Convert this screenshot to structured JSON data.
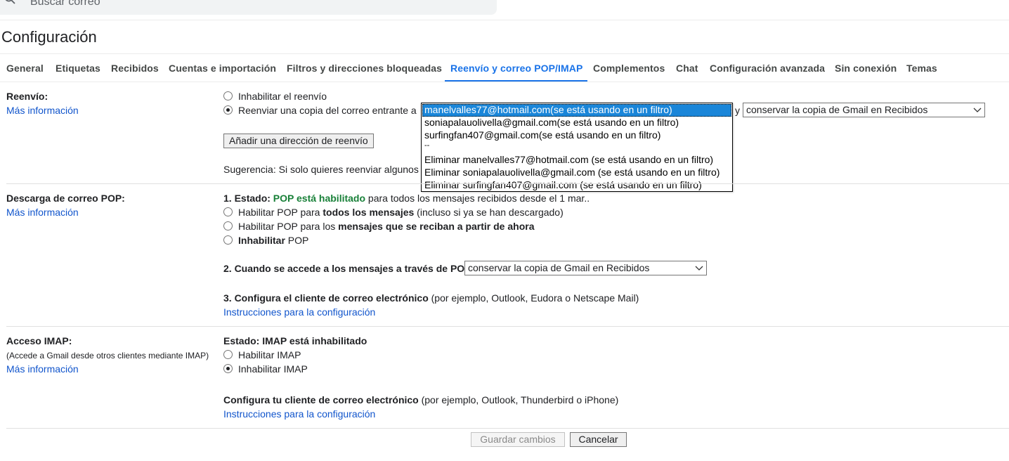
{
  "search": {
    "placeholder": "Buscar correo"
  },
  "page": {
    "title": "Configuración"
  },
  "tabs": [
    {
      "label": "General"
    },
    {
      "label": "Etiquetas"
    },
    {
      "label": "Recibidos"
    },
    {
      "label": "Cuentas e importación"
    },
    {
      "label": "Filtros y direcciones bloqueadas"
    },
    {
      "label": "Reenvío y correo POP/IMAP",
      "active": true
    },
    {
      "label": "Complementos"
    },
    {
      "label": "Chat"
    },
    {
      "label": "Configuración avanzada"
    },
    {
      "label": "Sin conexión"
    },
    {
      "label": "Temas"
    }
  ],
  "forwarding": {
    "label": "Reenvío:",
    "more_info": "Más información",
    "disable_option": "Inhabilitar el reenvío",
    "forward_option": "Reenviar una copia del correo entrante a",
    "selected_address": "manelvalles77@hotmail.com(se está usando en un filtro)",
    "y": "y",
    "action_select": "conservar la copia de Gmail en Recibidos",
    "add_button": "Añadir una dirección de reenvío",
    "tip": "Sugerencia: Si solo quieres reenviar algunos",
    "dropdown_options": [
      "manelvalles77@hotmail.com(se está usando en un filtro)",
      "soniapalauolivella@gmail.com(se está usando en un filtro)",
      "surfingfan407@gmail.com(se está usando en un filtro)",
      "--",
      "Eliminar manelvalles77@hotmail.com (se está usando en un filtro)",
      "Eliminar soniapalauolivella@gmail.com (se está usando en un filtro)",
      "Eliminar surfingfan407@gmail.com (se está usando en un filtro)"
    ]
  },
  "pop": {
    "label": "Descarga de correo POP:",
    "more_info": "Más información",
    "status_prefix": "1. Estado: ",
    "status_value": "POP está habilitado",
    "status_suffix": " para todos los mensajes recibidos desde el 1 mar..",
    "opt1_a": "Habilitar POP para ",
    "opt1_b": "todos los mensajes",
    "opt1_c": " (incluso si ya se han descargado)",
    "opt2_a": "Habilitar POP para los ",
    "opt2_b": "mensajes que se reciban a partir de ahora",
    "opt3_a": "Inhabilitar",
    "opt3_b": " POP",
    "step2": "2. Cuando se accede a los mensajes a través de POP",
    "step2_select": "conservar la copia de Gmail en Recibidos",
    "step3_a": "3. Configura el cliente de correo electrónico",
    "step3_b": " (por ejemplo, Outlook, Eudora o Netscape Mail)",
    "instructions": "Instrucciones para la configuración"
  },
  "imap": {
    "label": "Acceso IMAP:",
    "sublabel": "(Accede a Gmail desde otros clientes mediante IMAP)",
    "more_info": "Más información",
    "status": "Estado: IMAP está inhabilitado",
    "enable": "Habilitar IMAP",
    "disable": "Inhabilitar IMAP",
    "config_a": "Configura tu cliente de correo electrónico",
    "config_b": " (por ejemplo, Outlook, Thunderbird o iPhone)",
    "instructions": "Instrucciones para la configuración"
  },
  "footer": {
    "save": "Guardar cambios",
    "cancel": "Cancelar"
  },
  "colors": {
    "accent": "#1a73e8",
    "link": "#1155cc",
    "enabled_green": "#188038",
    "selected_option": "#1a86d9"
  }
}
